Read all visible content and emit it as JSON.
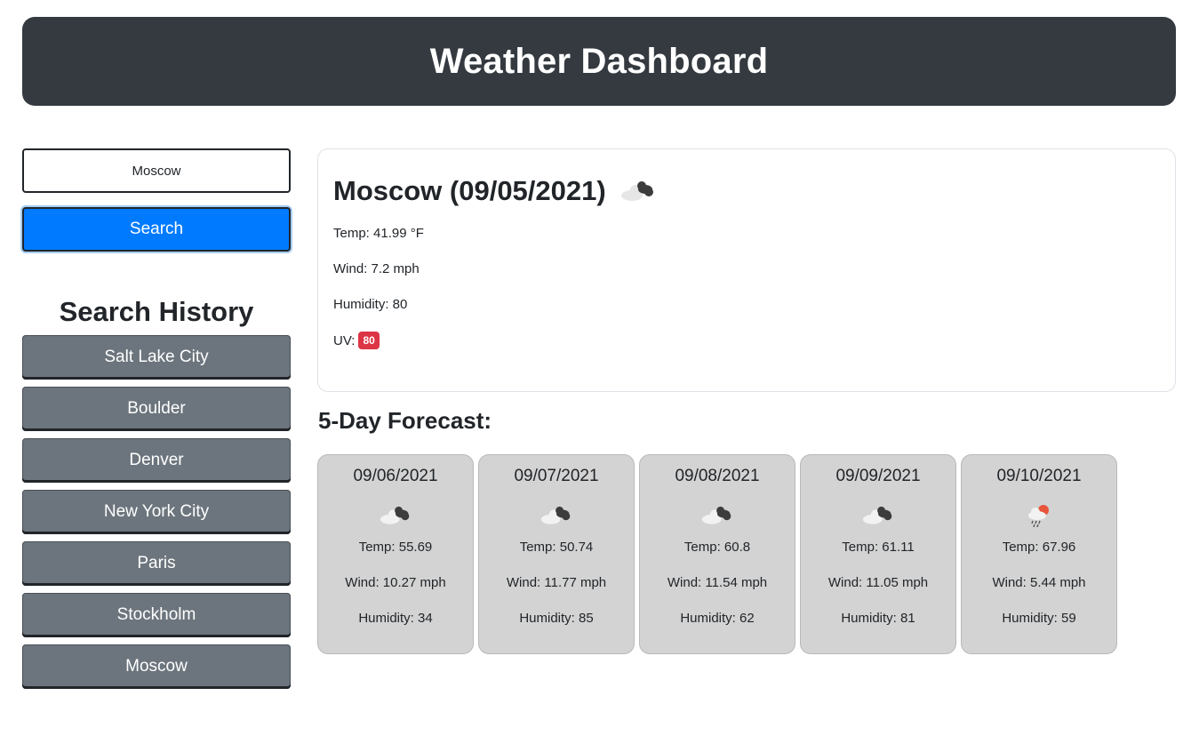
{
  "header": {
    "title": "Weather Dashboard"
  },
  "search": {
    "value": "Moscow",
    "button_label": "Search"
  },
  "history": {
    "title": "Search History",
    "items": [
      "Salt Lake City",
      "Boulder",
      "Denver",
      "New York City",
      "Paris",
      "Stockholm",
      "Moscow"
    ]
  },
  "current": {
    "title": "Moscow (09/05/2021)",
    "icon": "cloudy-icon",
    "temp": "Temp: 41.99 °F",
    "wind": "Wind: 7.2 mph",
    "humidity": "Humidity: 80",
    "uv_label": "UV:",
    "uv_value": "80",
    "uv_color": "#dc3545"
  },
  "forecast": {
    "title": "5-Day Forecast:",
    "days": [
      {
        "date": "09/06/2021",
        "icon": "cloudy-icon",
        "temp": "Temp: 55.69",
        "wind": "Wind: 10.27 mph",
        "humidity": "Humidity: 34"
      },
      {
        "date": "09/07/2021",
        "icon": "cloudy-icon",
        "temp": "Temp: 50.74",
        "wind": "Wind: 11.77 mph",
        "humidity": "Humidity: 85"
      },
      {
        "date": "09/08/2021",
        "icon": "cloudy-icon",
        "temp": "Temp: 60.8",
        "wind": "Wind: 11.54 mph",
        "humidity": "Humidity: 62"
      },
      {
        "date": "09/09/2021",
        "icon": "cloudy-icon",
        "temp": "Temp: 61.11",
        "wind": "Wind: 11.05 mph",
        "humidity": "Humidity: 81"
      },
      {
        "date": "09/10/2021",
        "icon": "rain-sun-icon",
        "temp": "Temp: 67.96",
        "wind": "Wind: 5.44 mph",
        "humidity": "Humidity: 59"
      }
    ]
  },
  "colors": {
    "header_bg": "#343a40",
    "search_button": "#007bff",
    "history_button": "#6c757d",
    "card_bg": "#d3d3d3"
  }
}
